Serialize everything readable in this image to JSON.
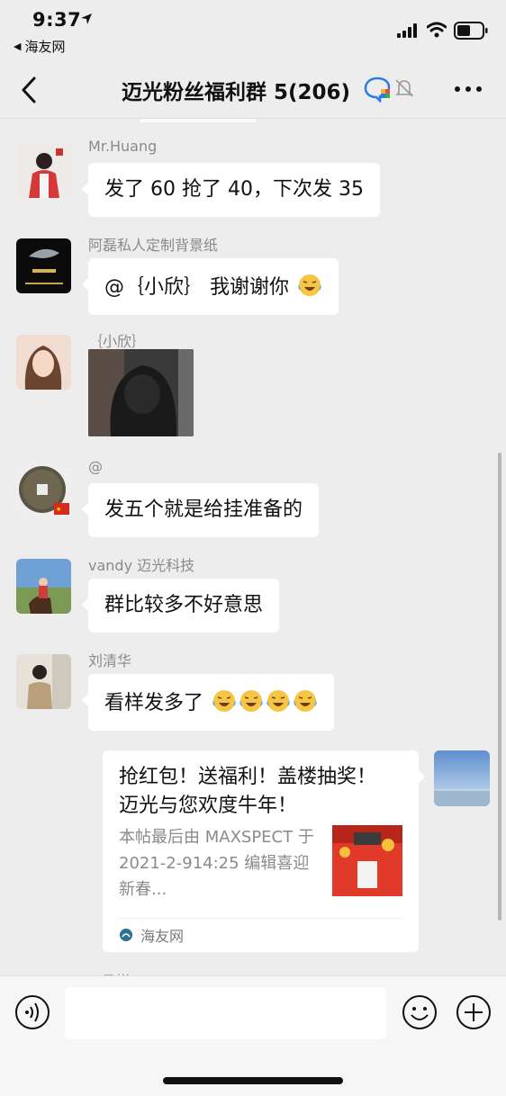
{
  "status_bar": {
    "time": "9:37",
    "back_app": "海友网"
  },
  "nav": {
    "title": "迈光粉丝福利群 5(206)"
  },
  "messages": [
    {
      "sender": "Mr.Huang",
      "text": "发了 60 抢了 40，下次发 35"
    },
    {
      "sender": "阿磊私人定制背景纸",
      "text": "@｛小欣｝ 我谢谢你"
    },
    {
      "sender": "｛小欣｝"
    },
    {
      "sender": "@",
      "text": "发五个就是给挂准备的"
    },
    {
      "sender": "vandy 迈光科技",
      "text": "群比较多不好意思"
    },
    {
      "sender": "刘清华",
      "text": "看样发多了"
    }
  ],
  "card": {
    "title": "抢红包！送福利！盖楼抽奖！迈光与您欢度牛年！",
    "description": "本帖最后由 MAXSPECT 于 2021-2-914:25 编辑喜迎新春...",
    "source": "海友网"
  },
  "cut_off_sender": "• 吕煤"
}
